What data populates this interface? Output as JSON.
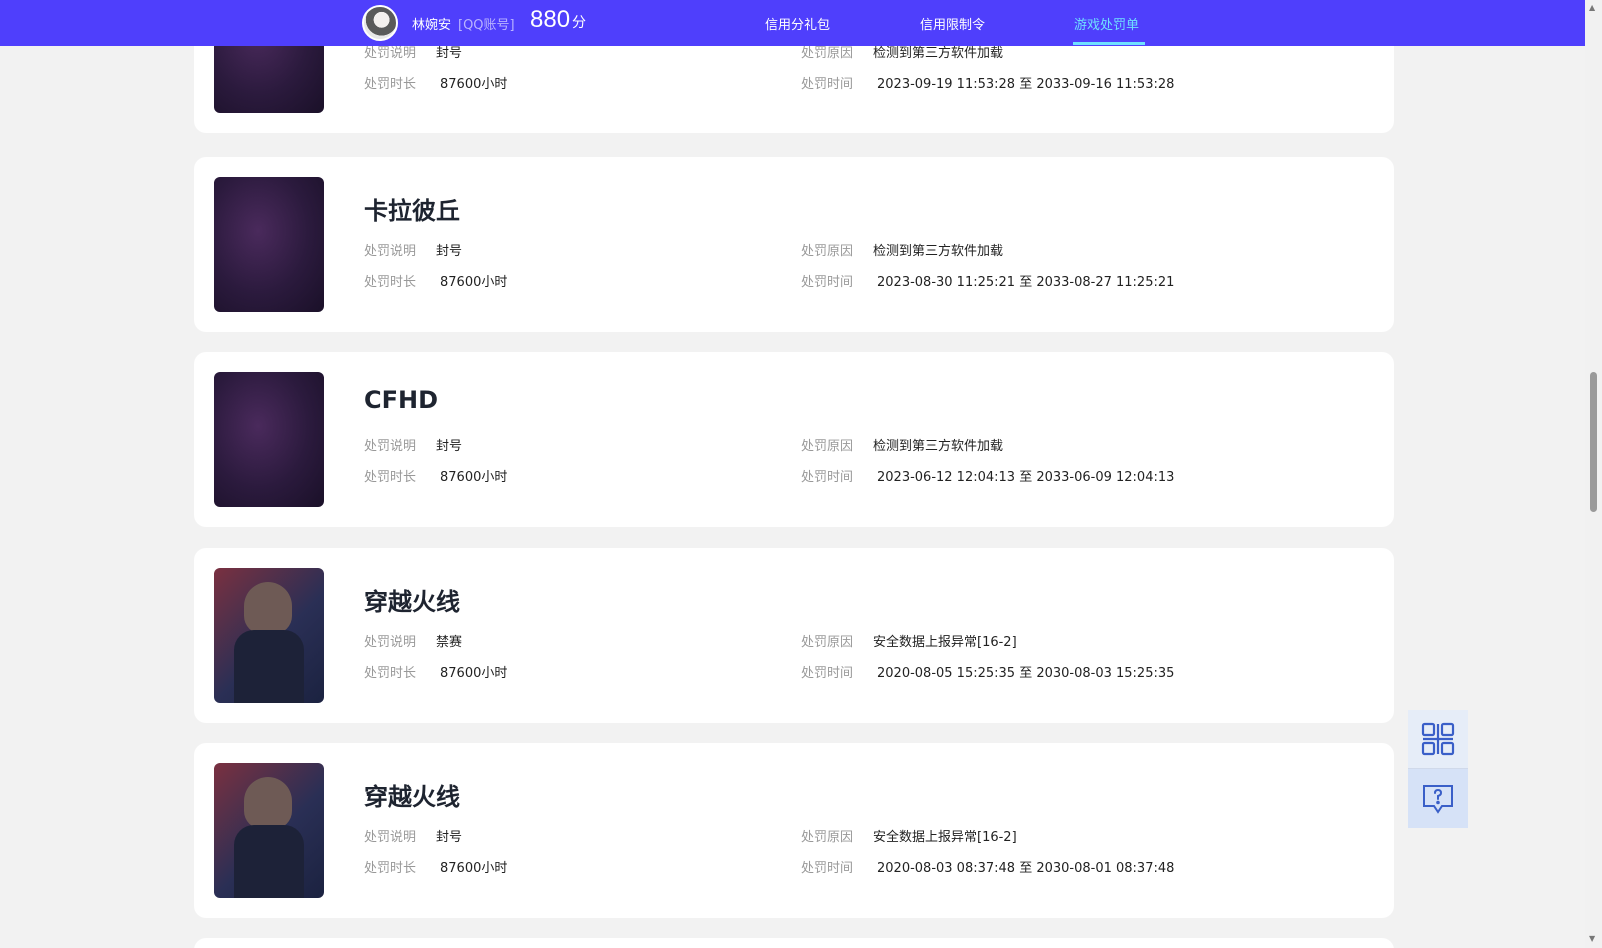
{
  "header": {
    "user_name": "林婉安",
    "account_type": "[QQ账号]",
    "score": "880",
    "score_unit": "分",
    "tabs": [
      {
        "label": "信用分礼包",
        "active": false
      },
      {
        "label": "信用限制令",
        "active": false
      },
      {
        "label": "游戏处罚单",
        "active": true
      }
    ]
  },
  "labels": {
    "desc": "处罚说明",
    "duration": "处罚时长",
    "reason": "处罚原因",
    "time": "处罚时间"
  },
  "records": [
    {
      "title": "",
      "desc": "封号",
      "duration": "87600小时",
      "reason": "检测到第三方软件加载",
      "time": "2023-09-19 11:53:28 至 2033-09-16 11:53:28",
      "thumb": "dark"
    },
    {
      "title": "卡拉彼丘",
      "desc": "封号",
      "duration": "87600小时",
      "reason": "检测到第三方软件加载",
      "time": "2023-08-30 11:25:21 至 2033-08-27 11:25:21",
      "thumb": "dark"
    },
    {
      "title": "CFHD",
      "desc": "封号",
      "duration": "87600小时",
      "reason": "检测到第三方软件加载",
      "time": "2023-06-12 12:04:13 至 2033-06-09 12:04:13",
      "thumb": "dark"
    },
    {
      "title": "穿越火线",
      "desc": "禁赛",
      "duration": "87600小时",
      "reason": "安全数据上报异常[16-2]",
      "time": "2020-08-05 15:25:35 至 2030-08-03 15:25:35",
      "thumb": "soldier"
    },
    {
      "title": "穿越火线",
      "desc": "封号",
      "duration": "87600小时",
      "reason": "安全数据上报异常[16-2]",
      "time": "2020-08-03 08:37:48 至 2030-08-01 08:37:48",
      "thumb": "soldier"
    }
  ],
  "side_panel": {
    "icons": [
      "qr-code-icon",
      "help-chat-icon"
    ]
  },
  "colors": {
    "header_bg": "#4f3ffc",
    "active_tab": "#6fe0ff",
    "page_bg": "#f2f2f2"
  }
}
